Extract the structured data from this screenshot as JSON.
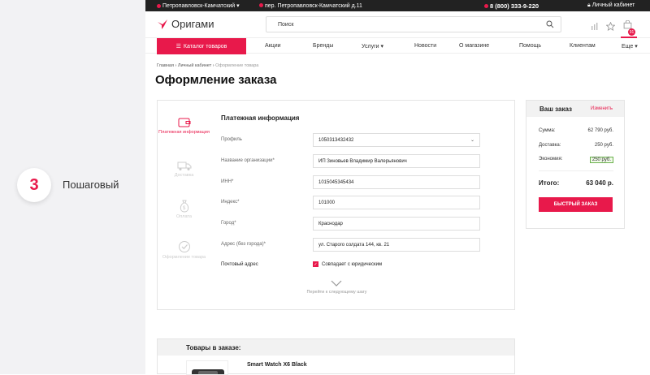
{
  "side": {
    "step_number": "3",
    "step_label": "Пошаговый"
  },
  "topbar": {
    "city": "Петропавловск-Камчатский",
    "address": "пер. Петропавловск-Камчатский д.11",
    "phone": "8 (800) 333-9-220",
    "account": "Личный кабинет"
  },
  "header": {
    "logo": "Оригами",
    "search_placeholder": "Поиск",
    "cart_count": "91"
  },
  "nav": {
    "catalog": "Каталог товаров",
    "items": [
      "Акции",
      "Бренды",
      "Услуги",
      "Новости",
      "О магазине",
      "Помощь",
      "Клиентам",
      "Еще"
    ]
  },
  "breadcrumbs": [
    "Главная",
    "Личный кабинет",
    "Оформление товара"
  ],
  "page_title": "Оформление заказа",
  "steps": [
    {
      "label": "Платежная информация",
      "active": true,
      "icon": "wallet-icon"
    },
    {
      "label": "Доставка",
      "active": false,
      "icon": "truck-icon"
    },
    {
      "label": "Оплата",
      "active": false,
      "icon": "money-bag-icon"
    },
    {
      "label": "Оформление товара",
      "active": false,
      "icon": "check-icon"
    }
  ],
  "form": {
    "title": "Платежная информация",
    "fields": [
      {
        "label": "Профиль",
        "value": "1050313432432"
      },
      {
        "label": "Название организации*",
        "value": "ИП Зиновьев Владимир Валерьянович"
      },
      {
        "label": "ИНН*",
        "value": "1015045345434"
      },
      {
        "label": "Индекс*",
        "value": "101000"
      },
      {
        "label": "Город*",
        "value": "Краснодар"
      },
      {
        "label": "Адрес (без города)*",
        "value": "ул. Старого солдата 144, кв. 21"
      }
    ],
    "postal_label": "Почтовый адрес",
    "postal_checkbox": "Совпадает с юридическим",
    "next_step": "Перейти к следующему шагу"
  },
  "order": {
    "title": "Ваш заказ",
    "edit": "Изменить",
    "rows": [
      {
        "label": "Сумма:",
        "value": "62 790 руб."
      },
      {
        "label": "Доставка:",
        "value": "250 руб."
      },
      {
        "label": "Экономия:",
        "value": "250 руб."
      }
    ],
    "total_label": "Итого:",
    "total_value": "63 040 р.",
    "quick_order": "БЫСТРЫЙ ЗАКАЗ"
  },
  "goods": {
    "title": "Товары в заказе:",
    "product": "Smart Watch X6 Black"
  },
  "colors": {
    "accent": "#e8194b",
    "sidebar": "#f2f2f4",
    "topbar": "#222222"
  }
}
